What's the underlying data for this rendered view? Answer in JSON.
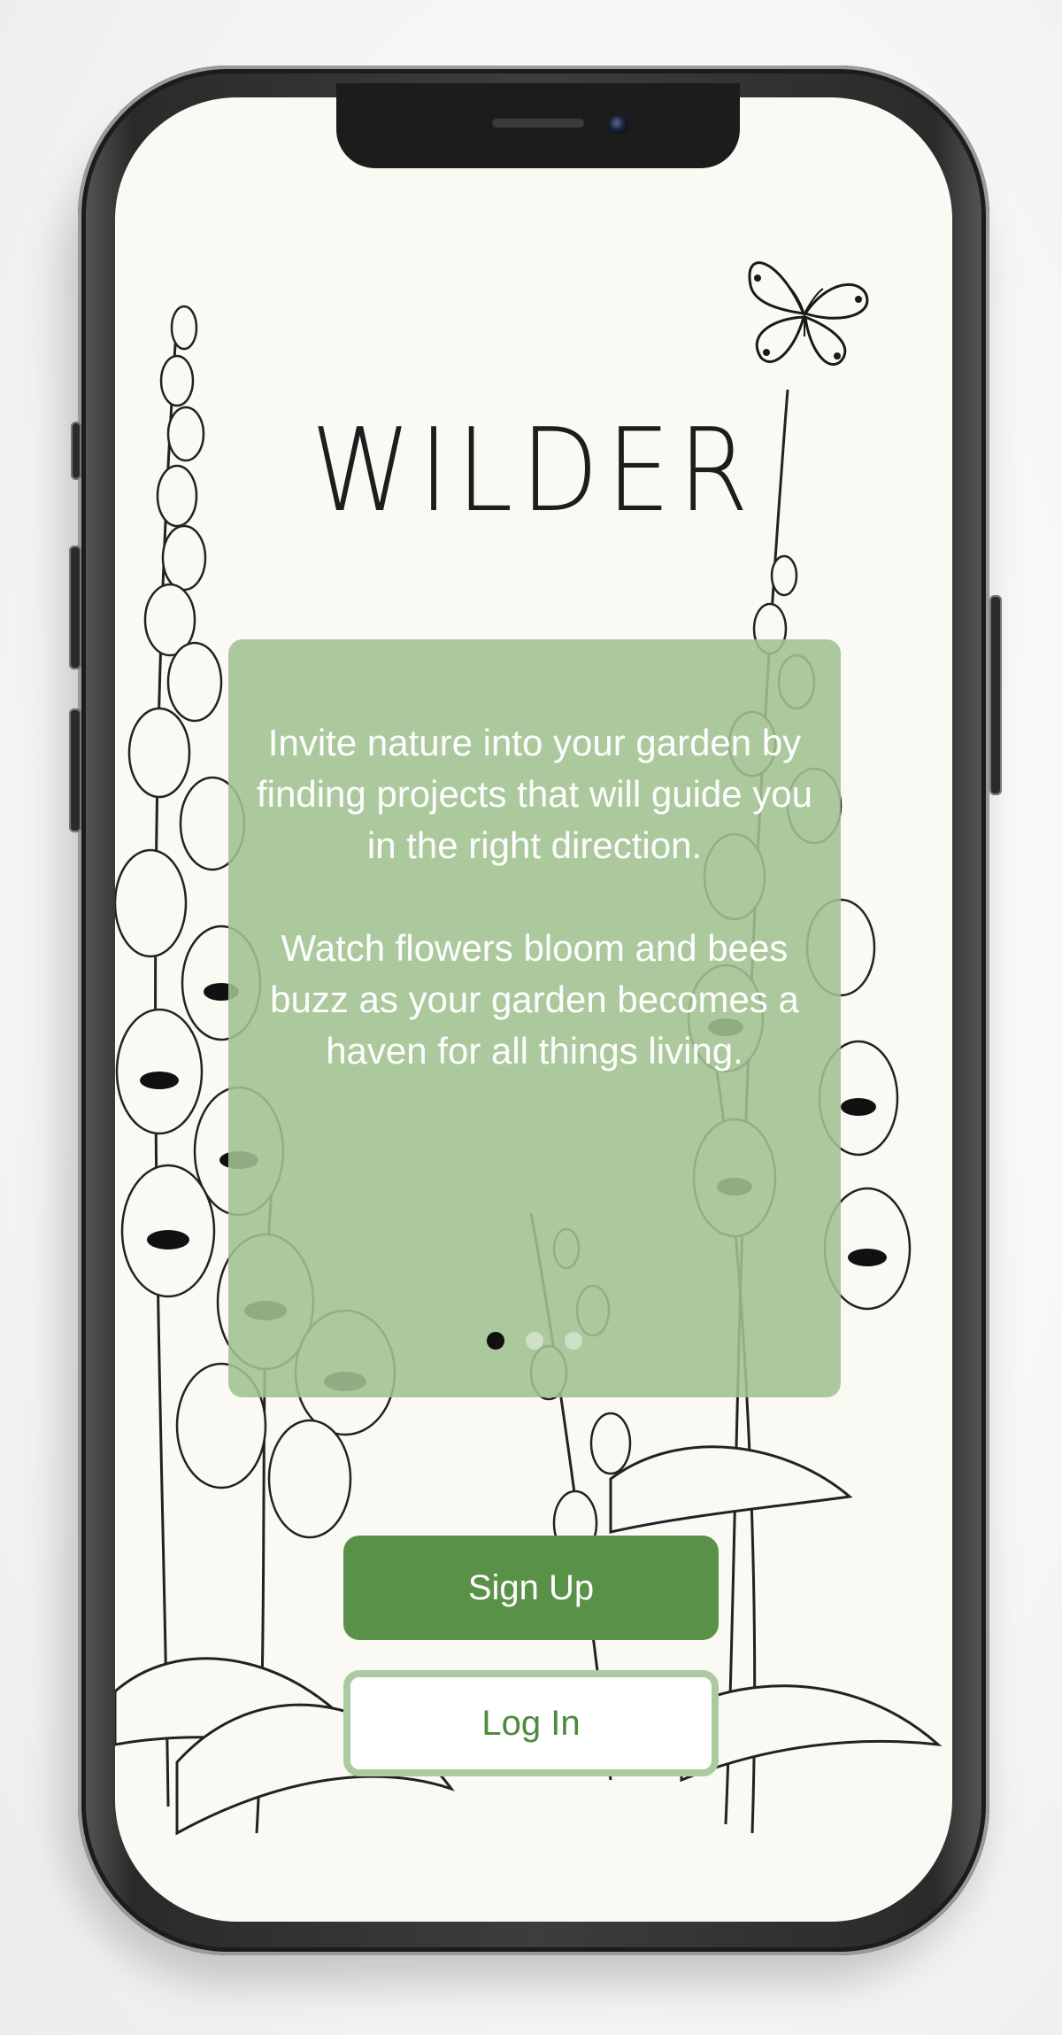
{
  "app": {
    "title": "WILDER"
  },
  "onboarding": {
    "paragraph_1": "Invite nature into your garden by finding projects that will guide you in  the right direction.",
    "paragraph_2": "Watch flowers bloom and bees buzz as your garden becomes a haven for all things living.",
    "pagination": {
      "current": 1,
      "total": 3
    }
  },
  "actions": {
    "signup_label": "Sign Up",
    "login_label": "Log In"
  },
  "colors": {
    "card": "#a0c192",
    "primary": "#5a9148",
    "outline": "#aacb9f",
    "background": "#fbf9f4"
  },
  "icons": [
    "butterfly-illustration",
    "foxglove-illustration"
  ]
}
